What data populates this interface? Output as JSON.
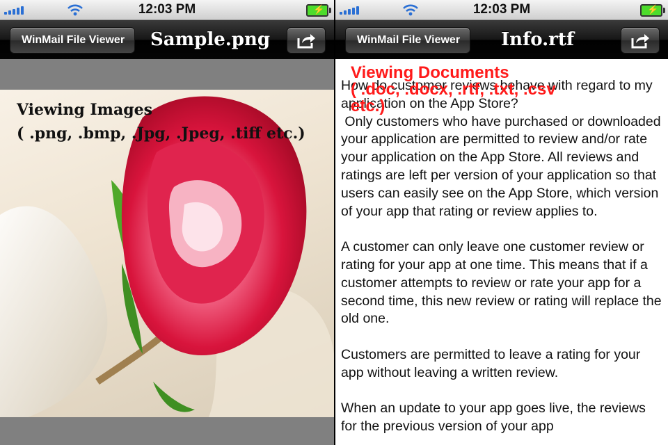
{
  "left_screen": {
    "status_bar": {
      "time": "12:03 PM"
    },
    "nav": {
      "back_label": "WinMail File Viewer",
      "title": "Sample.png"
    },
    "overlay": {
      "line1": "Viewing Images",
      "line2": "( .png, .bmp, .Jpg, .Jpeg, .tiff etc.)"
    }
  },
  "right_screen": {
    "status_bar": {
      "time": "12:03 PM"
    },
    "nav": {
      "back_label": "WinMail File Viewer",
      "title": "Info.rtf"
    },
    "overlay": {
      "line1": "Viewing Documents",
      "line2": "( .doc, .docx, .rtf, .txt, .csv",
      "line3": "etc.)"
    },
    "document": {
      "paragraphs": [
        "How do customer reviews behave with regard to my application on the App Store?\n Only customers who have purchased or downloaded your application are permitted to review and/or rate your application on the App Store. All reviews and ratings are left per version of your application so that users can easily see on the App Store, which version of your app that rating or review applies to.",
        "A customer can only leave one customer review or rating for your app at one time. This means that if a customer attempts to review or rate your app for a second time, this new review or rating will replace the old one.",
        "Customers are permitted to leave a rating for your app without leaving a written review.",
        "When an update to your app goes live, the reviews for the previous version of your app"
      ]
    }
  },
  "icons": {
    "signal": "signal-bars-icon",
    "wifi": "wifi-icon",
    "battery": "battery-charging-icon",
    "action": "share-export-icon"
  },
  "colors": {
    "overlay_red": "#ff1a1a",
    "signal_blue": "#2a6fd4",
    "battery_green": "#4ddc2c",
    "rose_red": "#d8143c"
  }
}
